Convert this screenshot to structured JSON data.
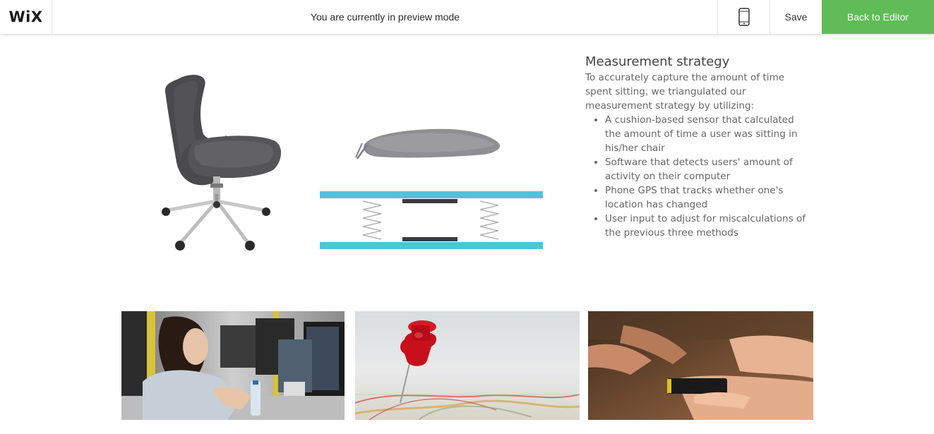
{
  "header": {
    "logo_text": "WiX",
    "preview_message": "You are currently in preview mode",
    "mobile_icon": "mobile-phone-icon",
    "save_label": "Save",
    "back_label": "Back to Editor",
    "accent_color": "#60bc57"
  },
  "section": {
    "title": "Measurement strategy",
    "intro": "To accurately capture the amount of time spent sitting, we triangulated our measurement strategy by utilizing:",
    "bullets": [
      "A cushion-based sensor that calculated the amount of time a user was sitting in his/her chair",
      "Software that detects users' amount of activity on their computer",
      "Phone GPS that tracks whether one's location has changed",
      "User input to adjust for miscalculations of the previous three methods"
    ]
  },
  "images": {
    "chair": "office-chair-image",
    "cushion": "cushion-sensor-diagram",
    "photo1": "woman-at-computer-photo",
    "photo2": "map-pushpin-photo",
    "photo3": "hands-holding-phone-photo"
  },
  "colors": {
    "sensor_plate": "#4fc3d9",
    "text_gray": "#666666"
  }
}
